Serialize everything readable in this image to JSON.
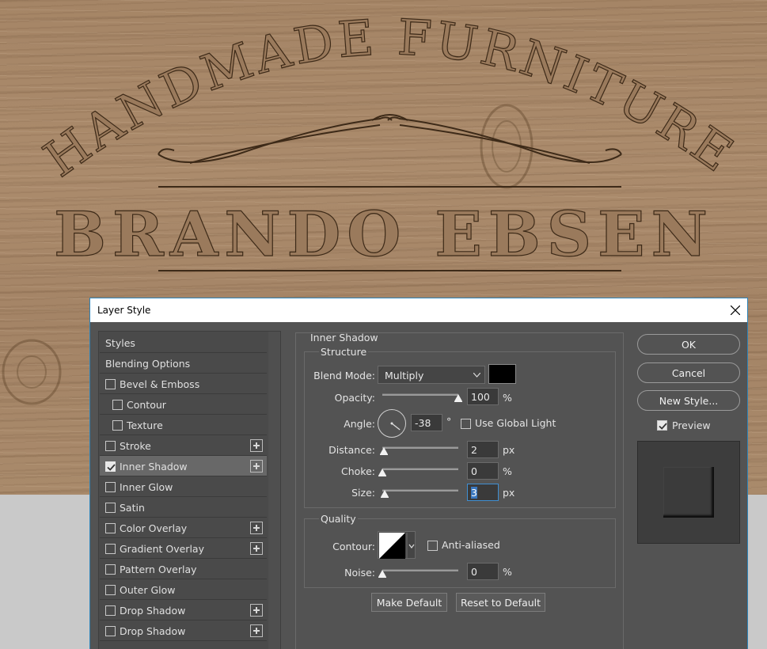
{
  "artwork": {
    "arc_text": "HANDMADE FURNITURE",
    "name_text": "BRANDO EBSEN"
  },
  "dialog": {
    "title": "Layer Style",
    "styles": [
      {
        "label": "Styles",
        "type": "header"
      },
      {
        "label": "Blending Options",
        "type": "header"
      },
      {
        "label": "Bevel & Emboss",
        "checked": false,
        "plus": false
      },
      {
        "label": "Contour",
        "checked": false,
        "plus": false,
        "sub": true
      },
      {
        "label": "Texture",
        "checked": false,
        "plus": false,
        "sub": true
      },
      {
        "label": "Stroke",
        "checked": false,
        "plus": true
      },
      {
        "label": "Inner Shadow",
        "checked": true,
        "plus": true,
        "active": true
      },
      {
        "label": "Inner Glow",
        "checked": false,
        "plus": false
      },
      {
        "label": "Satin",
        "checked": false,
        "plus": false
      },
      {
        "label": "Color Overlay",
        "checked": false,
        "plus": true
      },
      {
        "label": "Gradient Overlay",
        "checked": false,
        "plus": true
      },
      {
        "label": "Pattern Overlay",
        "checked": false,
        "plus": false
      },
      {
        "label": "Outer Glow",
        "checked": false,
        "plus": false
      },
      {
        "label": "Drop Shadow",
        "checked": false,
        "plus": true
      },
      {
        "label": "Drop Shadow",
        "checked": false,
        "plus": true
      }
    ],
    "section_title": "Inner Shadow",
    "structure": {
      "title": "Structure",
      "blend_mode_label": "Blend Mode:",
      "blend_mode_value": "Multiply",
      "shadow_color": "#000000",
      "opacity_label": "Opacity:",
      "opacity_value": "100",
      "opacity_unit": "%",
      "opacity_fraction": 1.0,
      "angle_label": "Angle:",
      "angle_value": "-38",
      "angle_unit": "°",
      "use_global_light_label": "Use Global Light",
      "use_global_light": false,
      "distance_label": "Distance:",
      "distance_value": "2",
      "distance_unit": "px",
      "distance_fraction": 0.02,
      "choke_label": "Choke:",
      "choke_value": "0",
      "choke_unit": "%",
      "choke_fraction": 0.0,
      "size_label": "Size:",
      "size_value": "3",
      "size_unit": "px",
      "size_fraction": 0.03
    },
    "quality": {
      "title": "Quality",
      "contour_label": "Contour:",
      "anti_aliased_label": "Anti-aliased",
      "anti_aliased": false,
      "noise_label": "Noise:",
      "noise_value": "0",
      "noise_unit": "%",
      "noise_fraction": 0.0
    },
    "make_default_label": "Make Default",
    "reset_default_label": "Reset to Default",
    "ok_label": "OK",
    "cancel_label": "Cancel",
    "new_style_label": "New Style...",
    "preview_label": "Preview",
    "preview_checked": true
  }
}
